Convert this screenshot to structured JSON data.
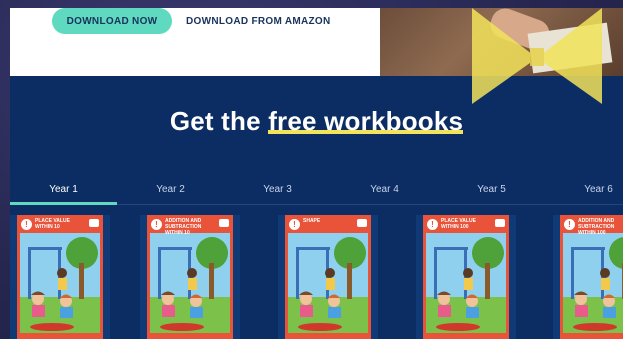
{
  "top": {
    "download_now": "DOWNLOAD NOW",
    "download_amazon": "DOWNLOAD FROM AMAZON"
  },
  "section": {
    "heading_prefix": "Get the ",
    "heading_highlight": "free workbooks",
    "accent": "#5fd9bf",
    "highlight_color": "#f2e35a",
    "background": "#0b2d63"
  },
  "tabs": [
    {
      "label": "Year 1",
      "active": true
    },
    {
      "label": "Year 2",
      "active": false
    },
    {
      "label": "Year 3",
      "active": false
    },
    {
      "label": "Year 4",
      "active": false
    },
    {
      "label": "Year 5",
      "active": false
    },
    {
      "label": "Year 6",
      "active": false
    }
  ],
  "workbooks": [
    {
      "title": "PLACE VALUE WITHIN 10"
    },
    {
      "title": "ADDITION AND SUBTRACTION WITHIN 10"
    },
    {
      "title": "SHAPE"
    },
    {
      "title": "PLACE VALUE WITHIN 100"
    },
    {
      "title": "ADDITION AND SUBTRACTION WITHIN 100"
    }
  ],
  "icons": {
    "badge": "number-badge-icon",
    "logo": "publisher-logo-icon",
    "bow": "ribbon-bow-icon"
  }
}
